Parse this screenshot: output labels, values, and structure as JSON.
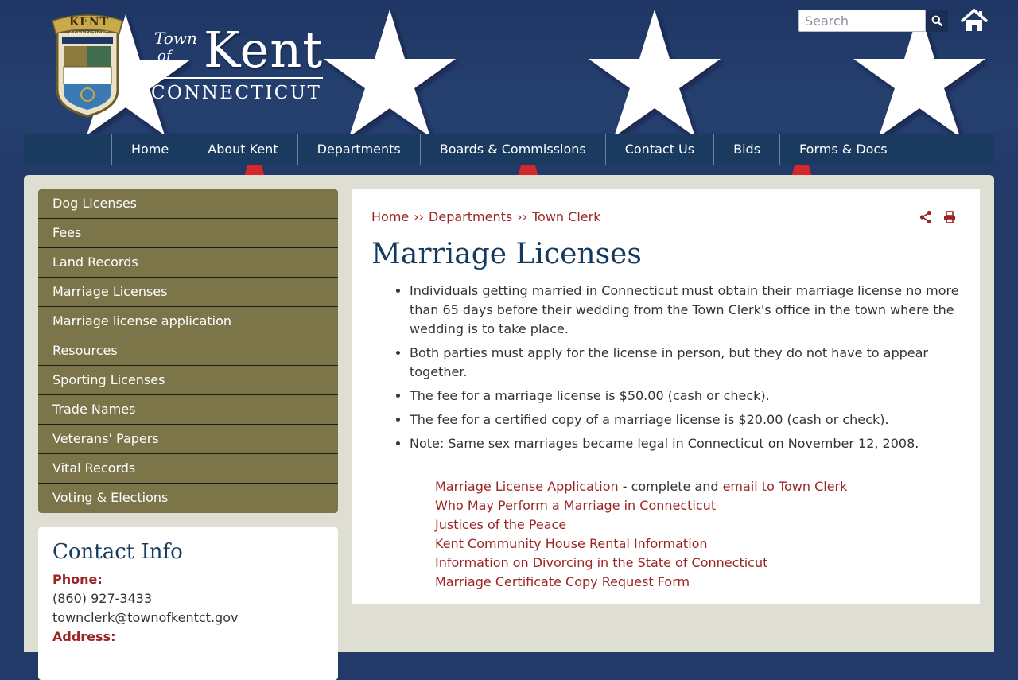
{
  "site": {
    "seal_text": "KENT",
    "seal_subtext": "CONNECTICUT",
    "brand_town": "Town",
    "brand_of": "of",
    "brand_name": "Kent",
    "brand_state": "CONNECTICUT"
  },
  "search": {
    "placeholder": "Search",
    "value": ""
  },
  "nav": {
    "items": [
      {
        "label": "Home"
      },
      {
        "label": "About Kent"
      },
      {
        "label": "Departments"
      },
      {
        "label": "Boards & Commissions"
      },
      {
        "label": "Contact Us"
      },
      {
        "label": "Bids"
      },
      {
        "label": "Forms & Docs"
      }
    ]
  },
  "sidebar": {
    "items": [
      {
        "label": "Dog Licenses"
      },
      {
        "label": "Fees"
      },
      {
        "label": "Land Records"
      },
      {
        "label": "Marriage Licenses"
      },
      {
        "label": "Marriage license application"
      },
      {
        "label": "Resources"
      },
      {
        "label": "Sporting Licenses"
      },
      {
        "label": "Trade Names"
      },
      {
        "label": "Veterans' Papers"
      },
      {
        "label": "Vital Records"
      },
      {
        "label": "Voting & Elections"
      }
    ]
  },
  "contact": {
    "title": "Contact Info",
    "phone_label": "Phone:",
    "phone": "(860) 927-3433",
    "email": "townclerk@townofkentct.gov",
    "address_label": "Address:"
  },
  "breadcrumb": {
    "items": [
      {
        "label": "Home"
      },
      {
        "label": "Departments"
      },
      {
        "label": "Town Clerk"
      }
    ],
    "separator": "››"
  },
  "page": {
    "title": "Marriage Licenses",
    "facts": [
      "Individuals getting married in Connecticut must obtain their marriage license no more than 65 days before their wedding from the Town Clerk's office in the town where the wedding is to take place.",
      "Both parties must apply for the license in person, but they do not have to appear together.",
      "The fee for a marriage license is $50.00 (cash or check).",
      "The fee for a certified copy of a marriage license is $20.00 (cash or check).",
      "Note: Same sex marriages became legal in Connecticut on November 12, 2008."
    ],
    "links": {
      "application": "Marriage License Application",
      "application_mid": " - complete and ",
      "email_clerk": "email to Town Clerk",
      "who_may_perform": "Who May Perform a Marriage in Connecticut",
      "justices": "Justices of the Peace",
      "community_house": "Kent Community House Rental Information",
      "divorcing": "Information on Divorcing in the State of Connecticut",
      "certificate_copy": "Marriage Certificate Copy Request Form"
    }
  },
  "colors": {
    "header_blue": "#233a68",
    "nav_blue": "#1a3a5f",
    "sidebar_olive": "#7b7549",
    "link_red": "#9b2424",
    "title_blue": "#143a5e",
    "frame_beige": "#dfded2"
  },
  "icons": [
    "search-icon",
    "home-icon",
    "share-icon",
    "print-icon"
  ]
}
